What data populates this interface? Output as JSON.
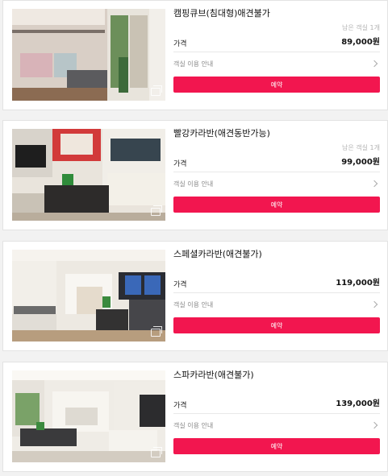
{
  "colors": {
    "accent": "#f2164f",
    "background": "#f2f2f2"
  },
  "rooms": [
    {
      "name": "캠핑큐브(침대형)애견불가",
      "stock_text": "남은 객실 1개",
      "price_label": "가격",
      "price": "89,000원",
      "guide_label": "객실 이용 안내",
      "reserve_label": "예약",
      "photo_icon": "gallery-icon"
    },
    {
      "name": "빨강카라반(애견동반가능)",
      "stock_text": "남은 객실 1개",
      "price_label": "가격",
      "price": "99,000원",
      "guide_label": "객실 이용 안내",
      "reserve_label": "예약",
      "photo_icon": "gallery-icon"
    },
    {
      "name": "스페셜카라반(애견불가)",
      "stock_text": "",
      "price_label": "가격",
      "price": "119,000원",
      "guide_label": "객실 이용 안내",
      "reserve_label": "예약",
      "photo_icon": "gallery-icon"
    },
    {
      "name": "스파카라반(애견불가)",
      "stock_text": "",
      "price_label": "가격",
      "price": "139,000원",
      "guide_label": "객실 이용 안내",
      "reserve_label": "예약",
      "photo_icon": "gallery-icon"
    }
  ]
}
